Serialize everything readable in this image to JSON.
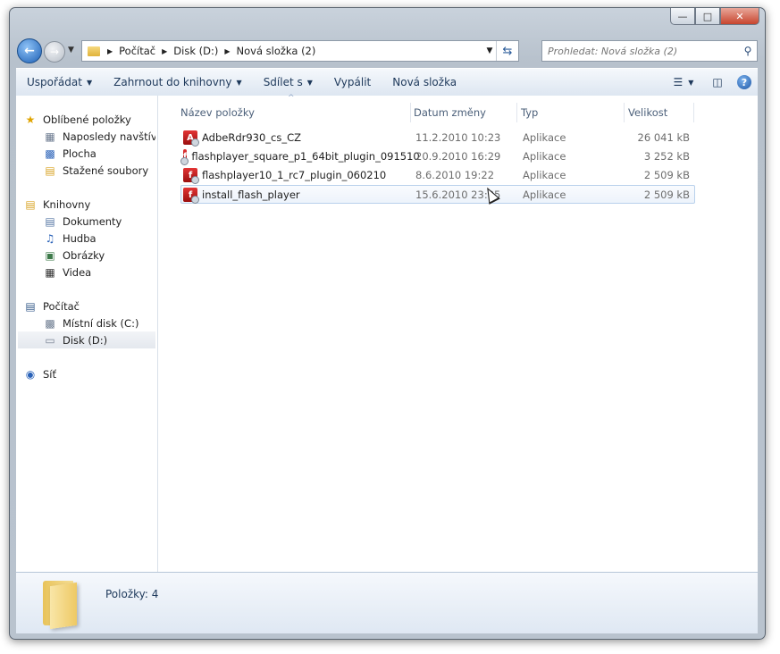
{
  "window": {
    "caption_buttons": {
      "minimize": "—",
      "maximize": "□",
      "close": "✕"
    }
  },
  "address_bar": {
    "breadcrumbs": [
      "Počítač",
      "Disk (D:)",
      "Nová složka (2)"
    ]
  },
  "search": {
    "placeholder": "Prohledat: Nová složka (2)"
  },
  "toolbar": {
    "organize": "Uspořádat",
    "include_in_library": "Zahrnout do knihovny",
    "share": "Sdílet s",
    "burn": "Vypálit",
    "new_folder": "Nová složka",
    "help": "?"
  },
  "nav": {
    "favorites": {
      "label": "Oblíbené položky",
      "items": [
        "Naposledy navštívené",
        "Plocha",
        "Stažené soubory"
      ]
    },
    "libraries": {
      "label": "Knihovny",
      "items": [
        "Dokumenty",
        "Hudba",
        "Obrázky",
        "Videa"
      ]
    },
    "computer": {
      "label": "Počítač",
      "items": [
        "Místní disk (C:)",
        "Disk (D:)"
      ]
    },
    "network": {
      "label": "Síť"
    }
  },
  "columns": {
    "name": "Název položky",
    "date": "Datum změny",
    "type": "Typ",
    "size": "Velikost"
  },
  "files": [
    {
      "name": "AdbeRdr930_cs_CZ",
      "date": "11.2.2010 10:23",
      "type": "Aplikace",
      "size": "26 041 kB"
    },
    {
      "name": "flashplayer_square_p1_64bit_plugin_091510",
      "date": "20.9.2010 16:29",
      "type": "Aplikace",
      "size": "3 252 kB"
    },
    {
      "name": "flashplayer10_1_rc7_plugin_060210",
      "date": "8.6.2010 19:22",
      "type": "Aplikace",
      "size": "2 509 kB"
    },
    {
      "name": "install_flash_player",
      "date": "15.6.2010 23:35",
      "type": "Aplikace",
      "size": "2 509 kB"
    }
  ],
  "details_pane": {
    "count": "Položky: 4"
  },
  "colors": {
    "accent": "#1e395b",
    "selection": "#b9d1ec",
    "chrome": "#c3ccd7"
  }
}
